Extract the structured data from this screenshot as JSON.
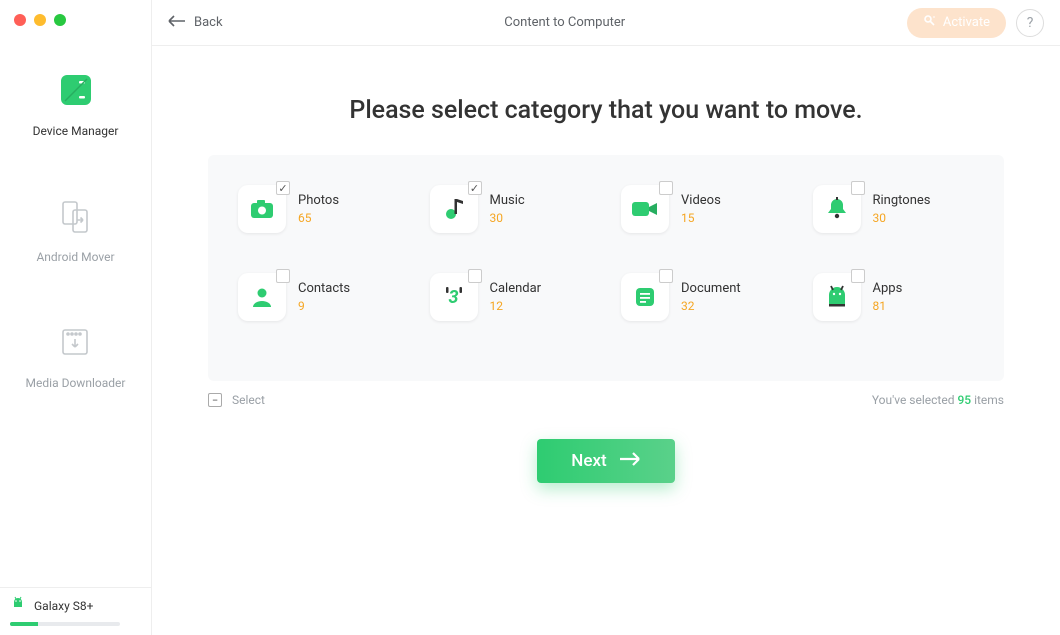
{
  "sidebar": {
    "items": [
      {
        "label": "Device Manager",
        "active": true
      },
      {
        "label": "Android Mover",
        "active": false
      },
      {
        "label": "Media Downloader",
        "active": false
      }
    ],
    "device": {
      "name": "Galaxy S8+",
      "storage_percent": 25
    }
  },
  "header": {
    "back_label": "Back",
    "title": "Content to Computer",
    "activate_label": "Activate",
    "help_label": "?"
  },
  "main": {
    "headline": "Please select category that you want to move.",
    "categories": [
      {
        "label": "Photos",
        "count": 65,
        "checked": true
      },
      {
        "label": "Music",
        "count": 30,
        "checked": true
      },
      {
        "label": "Videos",
        "count": 15,
        "checked": false
      },
      {
        "label": "Ringtones",
        "count": 30,
        "checked": false
      },
      {
        "label": "Contacts",
        "count": 9,
        "checked": false
      },
      {
        "label": "Calendar",
        "count": 12,
        "checked": false
      },
      {
        "label": "Document",
        "count": 32,
        "checked": false
      },
      {
        "label": "Apps",
        "count": 81,
        "checked": false
      }
    ],
    "select_all_label": "Select",
    "select_all_state": "indeterminate",
    "selected_prefix": "You've selected ",
    "selected_count": 95,
    "selected_suffix": " items",
    "next_label": "Next"
  },
  "icons": {
    "calendar_number": "3"
  }
}
